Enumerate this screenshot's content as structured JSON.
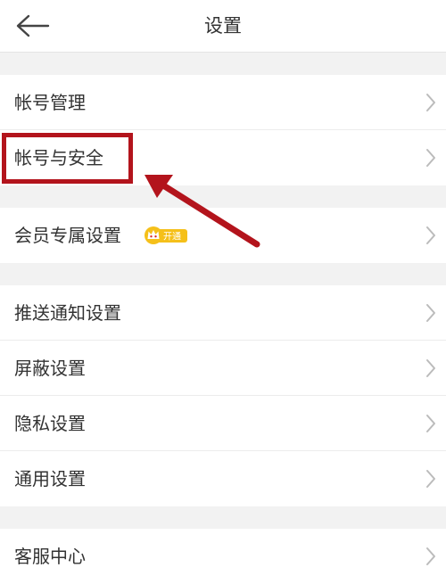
{
  "header": {
    "title": "设置",
    "back_icon": "arrow-left-icon"
  },
  "groups": [
    {
      "items": [
        {
          "label": "帐号管理"
        },
        {
          "label": "帐号与安全"
        }
      ]
    },
    {
      "items": [
        {
          "label": "会员专属设置",
          "badge_label": "开通",
          "badge_icon": "crown-icon"
        }
      ]
    },
    {
      "items": [
        {
          "label": "推送通知设置"
        },
        {
          "label": "屏蔽设置"
        },
        {
          "label": "隐私设置"
        },
        {
          "label": "通用设置"
        }
      ]
    },
    {
      "items": [
        {
          "label": "客服中心"
        }
      ]
    }
  ],
  "colors": {
    "background": "#f2f2f2",
    "row_background": "#ffffff",
    "text": "#333333",
    "chevron": "#bbbbbb",
    "annotation": "#b3141c",
    "badge": "#f5c01a"
  }
}
